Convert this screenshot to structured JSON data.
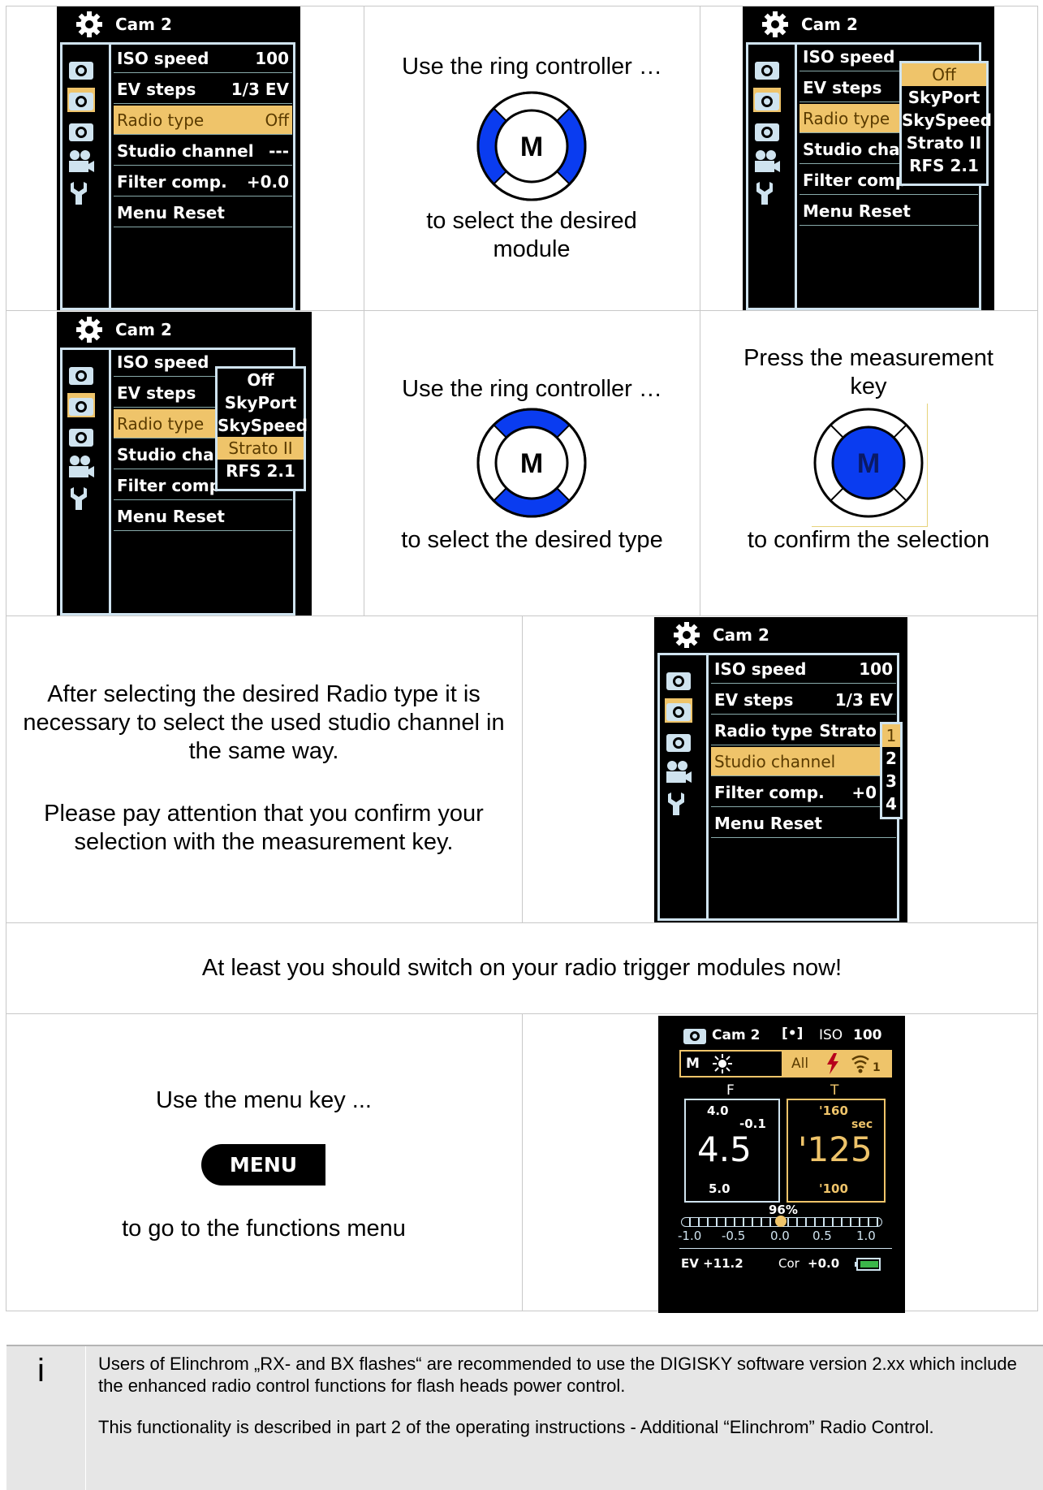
{
  "colors": {
    "highlight": "#efc46a",
    "ring_blue": "#0a3cf0",
    "screen_border": "#cfe3ef"
  },
  "screen_common": {
    "title": "Cam 2",
    "rows": [
      "ISO speed",
      "EV steps",
      "Radio type",
      "Studio channel",
      "Filter comp.",
      "Menu Reset"
    ],
    "values": [
      "100",
      "1/3 EV",
      "Off",
      "---",
      "+0.0"
    ]
  },
  "popup": {
    "options": [
      "Off",
      "SkyPort",
      "SkySpeed",
      "Strato II",
      "RFS 2.1"
    ]
  },
  "row1": {
    "caption_top": "Use the ring controller …",
    "ring_label": "M",
    "caption_bottom": "to select the desired module"
  },
  "row2": {
    "caption_top": "Use the ring controller …",
    "ring_label": "M",
    "caption_bottom": "to select the desired type",
    "press_top": "Press the measurement key",
    "press_label": "M",
    "press_bottom": "to confirm the selection"
  },
  "row3": {
    "para1": "After selecting the desired Radio type it is necessary to select the used studio channel in the same way.",
    "para2": "Please pay attention that you confirm your selection with the measurement key.",
    "screen": {
      "studio_short": "Strato",
      "filter_short": "+0",
      "channels": [
        "1",
        "2",
        "3",
        "4"
      ]
    }
  },
  "row4": {
    "text": "At least you should switch on your radio trigger modules now!"
  },
  "row5": {
    "text_top": "Use the menu key ...",
    "menu_key": "MENU",
    "text_bottom": "to go to the functions menu",
    "meter": {
      "title": "Cam 2",
      "mode_icon": "[•]",
      "iso_label": "ISO",
      "iso": "100",
      "mode": "M",
      "all": "All",
      "channel": "1",
      "f_label": "F",
      "t_label": "T",
      "f_top": "4.0",
      "f_offset": "-0.1",
      "f_main": "4.5",
      "f_bottom": "5.0",
      "t_top": "'160",
      "t_unit": "sec",
      "t_main": "'125",
      "t_bottom": "'100",
      "percent": "96%",
      "scale": [
        "-1.0",
        "-0.5",
        "0.0",
        "0.5",
        "1.0"
      ],
      "ev": "EV +11.2",
      "cor_label": "Cor",
      "cor": "+0.0"
    }
  },
  "info": {
    "icon": "i",
    "para1": "Users of Elinchrom „RX- and BX flashes“ are recommended to use the DIGISKY software version 2.xx which include the enhanced radio control functions for flash heads power control.",
    "para2": "This functionality is described in part 2 of the operating instructions - Additional “Elinchrom” Radio Control."
  }
}
